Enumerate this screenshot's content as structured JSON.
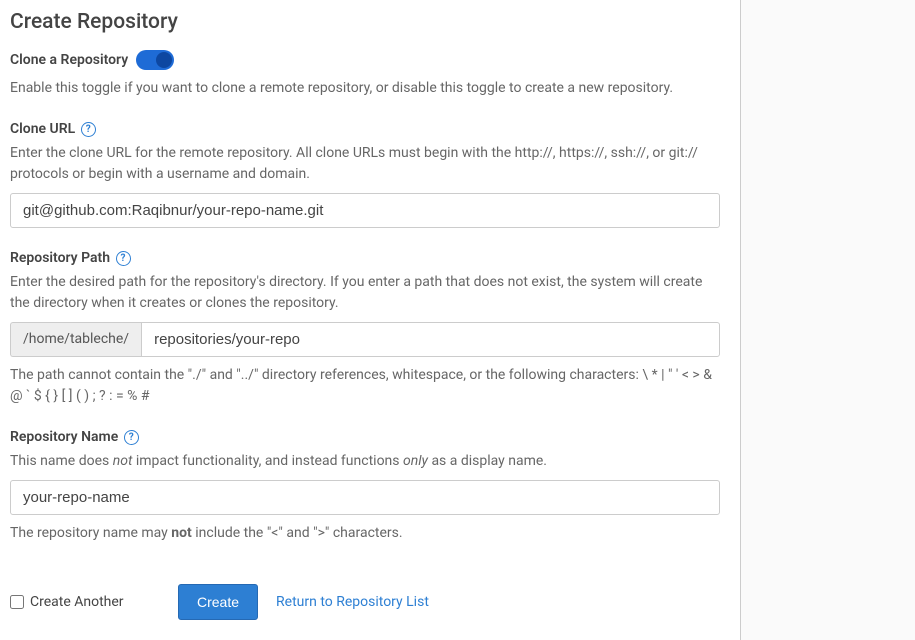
{
  "page": {
    "title": "Create Repository"
  },
  "cloneToggle": {
    "label": "Clone a Repository",
    "on": true,
    "description": "Enable this toggle if you want to clone a remote repository, or disable this toggle to create a new repository."
  },
  "cloneUrl": {
    "label": "Clone URL",
    "description": "Enter the clone URL for the remote repository. All clone URLs must begin with the http://, https://, ssh://, or git:// protocols or begin with a username and domain.",
    "value": "git@github.com:Raqibnur/your-repo-name.git"
  },
  "repoPath": {
    "label": "Repository Path",
    "description": "Enter the desired path for the repository's directory. If you enter a path that does not exist, the system will create the directory when it creates or clones the repository.",
    "prefix": "/home/tableche/",
    "value": "repositories/your-repo",
    "hint": "The path cannot contain the \"./\" and \"../\" directory references, whitespace, or the following characters: \\ * | \" ' < > & @ ` $ { } [ ] ( ) ; ? : = % #"
  },
  "repoName": {
    "label": "Repository Name",
    "desc_prefix": "This name does ",
    "desc_not": "not",
    "desc_mid": " impact functionality, and instead functions ",
    "desc_only": "only",
    "desc_suffix": " as a display name.",
    "value": "your-repo-name",
    "hint_prefix": "The repository name may ",
    "hint_not": "not",
    "hint_suffix": " include the \"<\" and \">\" characters."
  },
  "actions": {
    "createAnother": "Create Another",
    "createButton": "Create",
    "returnLink": "Return to Repository List"
  },
  "icons": {
    "help": "?"
  }
}
